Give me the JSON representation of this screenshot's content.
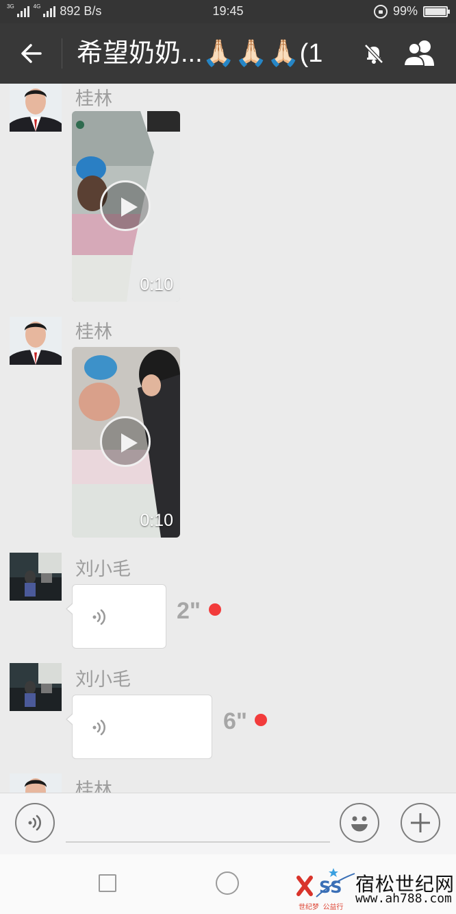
{
  "status_bar": {
    "network": "3G",
    "network2": "4G",
    "speed": "892 B/s",
    "time": "19:45",
    "battery": "99%",
    "battery_level": 0.99
  },
  "header": {
    "title": "希望奶奶...🙏🏻🙏🏻🙏🏻(1",
    "back_icon": "arrow-left-icon",
    "mute_icon": "bell-off-icon",
    "group_icon": "group-members-icon"
  },
  "messages": [
    {
      "type": "video",
      "sender": "桂林",
      "duration": "0:10"
    },
    {
      "type": "video",
      "sender": "桂林",
      "duration": "0:10"
    },
    {
      "type": "voice",
      "sender": "刘小毛",
      "length": "2\"",
      "unread": true
    },
    {
      "type": "voice",
      "sender": "刘小毛",
      "length": "6\"",
      "unread": true
    },
    {
      "type": "partial",
      "sender": "桂林"
    }
  ],
  "input_bar": {
    "voice_icon": "voice-input-icon",
    "emoji_icon": "emoji-icon",
    "plus_icon": "plus-icon"
  },
  "watermark": {
    "title": "宿松世纪网",
    "url": "www.ah788.com",
    "logo_text": "SS",
    "tagline_left": "世纪梦",
    "tagline_right": "公益行"
  },
  "colors": {
    "header_bg": "#383838",
    "status_bg": "#353535",
    "chat_bg": "#ebebeb",
    "unread_dot": "#f23b3b"
  }
}
